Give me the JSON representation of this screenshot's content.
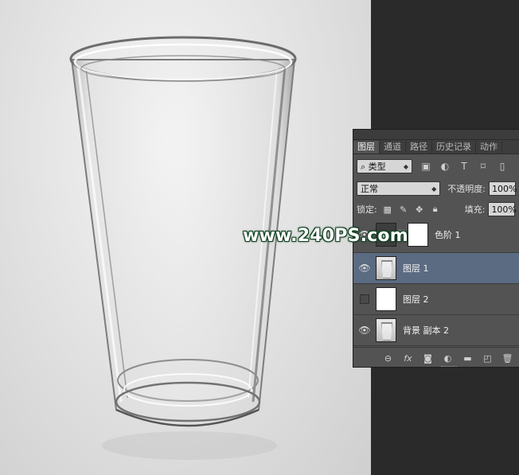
{
  "watermark": "www.240PS.com",
  "panel": {
    "tabs": [
      {
        "label": "图层",
        "active": true
      },
      {
        "label": "通道",
        "active": false
      },
      {
        "label": "路径",
        "active": false
      },
      {
        "label": "历史记录",
        "active": false
      },
      {
        "label": "动作",
        "active": false
      }
    ],
    "filter": {
      "search_glyph": "⌕",
      "kind_label": "类型"
    },
    "filter_icons": [
      "image-filter-icon",
      "adjustment-filter-icon",
      "type-filter-icon",
      "shape-filter-icon",
      "smart-object-filter-icon"
    ],
    "blend_mode": "正常",
    "opacity_label": "不透明度:",
    "opacity_value": "100%",
    "lock_label": "锁定:",
    "fill_label": "填充:",
    "fill_value": "100%",
    "layers": [
      {
        "name": "色阶 1",
        "visible": true,
        "selected": false,
        "kind": "adjustment"
      },
      {
        "name": "图层 1",
        "visible": true,
        "selected": true,
        "kind": "glass"
      },
      {
        "name": "图层 2",
        "visible": false,
        "selected": false,
        "kind": "white"
      },
      {
        "name": "背景 副本 2",
        "visible": true,
        "selected": false,
        "kind": "glass"
      }
    ]
  }
}
